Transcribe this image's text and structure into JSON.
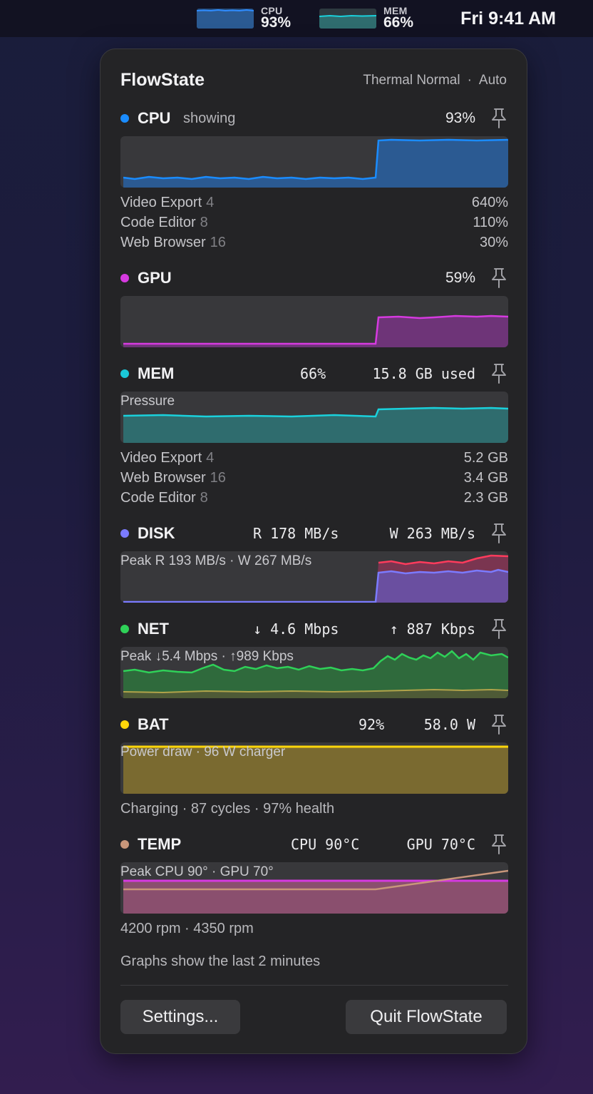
{
  "menubar": {
    "cpu_label": "CPU",
    "cpu_value": "93%",
    "mem_label": "MEM",
    "mem_value": "66%",
    "clock": "Fri 9:41 AM"
  },
  "panel": {
    "title": "FlowState",
    "thermal": "Thermal Normal",
    "separator": "·",
    "mode": "Auto"
  },
  "cpu": {
    "name": "CPU",
    "sub": "showing",
    "value": "93%",
    "color": "#1a8cff",
    "processes": [
      {
        "name": "Video Export",
        "count": "4",
        "value": "640%"
      },
      {
        "name": "Code Editor",
        "count": "8",
        "value": "110%"
      },
      {
        "name": "Web Browser",
        "count": "16",
        "value": "30%"
      }
    ]
  },
  "gpu": {
    "name": "GPU",
    "value": "59%",
    "color": "#d63ae0"
  },
  "mem": {
    "name": "MEM",
    "value": "66%",
    "used": "15.8 GB used",
    "color": "#1ac8d8",
    "caption": "Pressure",
    "processes": [
      {
        "name": "Video Export",
        "count": "4",
        "value": "5.2 GB"
      },
      {
        "name": "Web Browser",
        "count": "16",
        "value": "3.4 GB"
      },
      {
        "name": "Code Editor",
        "count": "8",
        "value": "2.3 GB"
      }
    ]
  },
  "disk": {
    "name": "DISK",
    "read": "R 178 MB/s",
    "write": "W 263 MB/s",
    "color": "#7b7bff",
    "caption": "Peak R 193 MB/s · W 267 MB/s"
  },
  "net": {
    "name": "NET",
    "down": "↓ 4.6 Mbps",
    "up": "↑ 887 Kbps",
    "color": "#2fd158",
    "caption": "Peak ↓5.4 Mbps · ↑989 Kbps"
  },
  "bat": {
    "name": "BAT",
    "value": "92%",
    "power": "58.0 W",
    "color": "#ffd60a",
    "caption": "Power draw · 96 W charger",
    "info": "Charging · 87 cycles · 97% health"
  },
  "temp": {
    "name": "TEMP",
    "cpu": "CPU 90°C",
    "gpu": "GPU 70°C",
    "color": "#c8967a",
    "caption": "Peak CPU 90° · GPU 70°",
    "info": "4200 rpm · 4350 rpm"
  },
  "footer": {
    "note": "Graphs show the last 2 minutes",
    "settings_label": "Settings...",
    "quit_label": "Quit FlowState"
  },
  "icons": {
    "pin": "pin-icon"
  }
}
